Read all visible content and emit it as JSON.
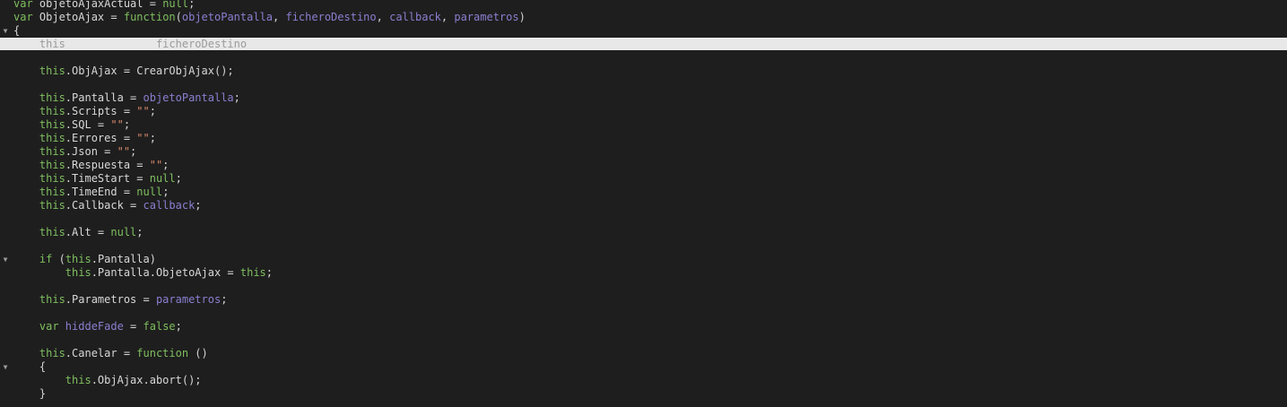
{
  "editor": {
    "lines": [
      {
        "y": 0,
        "fold": "",
        "tokens": [
          {
            "t": "var ",
            "c": "kw"
          },
          {
            "t": "objetoAjaxActual",
            "c": "id"
          },
          {
            "t": " = ",
            "c": "op"
          },
          {
            "t": "null",
            "c": "kw"
          },
          {
            "t": ";",
            "c": "op"
          }
        ]
      },
      {
        "y": 1,
        "fold": "",
        "tokens": [
          {
            "t": "var ",
            "c": "kw"
          },
          {
            "t": "ObjetoAjax",
            "c": "id"
          },
          {
            "t": " = ",
            "c": "op"
          },
          {
            "t": "function",
            "c": "kw"
          },
          {
            "t": "(",
            "c": "op"
          },
          {
            "t": "objetoPantalla",
            "c": "param"
          },
          {
            "t": ", ",
            "c": "op"
          },
          {
            "t": "ficheroDestino",
            "c": "param"
          },
          {
            "t": ", ",
            "c": "op"
          },
          {
            "t": "callback",
            "c": "param"
          },
          {
            "t": ", ",
            "c": "op"
          },
          {
            "t": "parametros",
            "c": "param"
          },
          {
            "t": ")",
            "c": "op"
          }
        ]
      },
      {
        "y": 2,
        "fold": "▼",
        "tokens": [
          {
            "t": "{",
            "c": "op"
          }
        ]
      },
      {
        "y": 3,
        "fold": "",
        "highlight": true,
        "tokens": [
          {
            "t": "    this",
            "c": "faded"
          },
          {
            "t": "              ",
            "c": "op"
          },
          {
            "t": "ficheroDestino",
            "c": "faded"
          }
        ]
      },
      {
        "y": 5,
        "fold": "",
        "tokens": [
          {
            "t": "    this",
            "c": "kw"
          },
          {
            "t": ".ObjAjax = ",
            "c": "id"
          },
          {
            "t": "CrearObjAjax",
            "c": "id"
          },
          {
            "t": "();",
            "c": "op"
          }
        ]
      },
      {
        "y": 7,
        "fold": "",
        "tokens": [
          {
            "t": "    this",
            "c": "kw"
          },
          {
            "t": ".Pantalla = ",
            "c": "id"
          },
          {
            "t": "objetoPantalla",
            "c": "param"
          },
          {
            "t": ";",
            "c": "op"
          }
        ]
      },
      {
        "y": 8,
        "fold": "",
        "tokens": [
          {
            "t": "    this",
            "c": "kw"
          },
          {
            "t": ".Scripts = ",
            "c": "id"
          },
          {
            "t": "\"\"",
            "c": "str"
          },
          {
            "t": ";",
            "c": "op"
          }
        ]
      },
      {
        "y": 9,
        "fold": "",
        "tokens": [
          {
            "t": "    this",
            "c": "kw"
          },
          {
            "t": ".SQL = ",
            "c": "id"
          },
          {
            "t": "\"\"",
            "c": "str"
          },
          {
            "t": ";",
            "c": "op"
          }
        ]
      },
      {
        "y": 10,
        "fold": "",
        "tokens": [
          {
            "t": "    this",
            "c": "kw"
          },
          {
            "t": ".Errores = ",
            "c": "id"
          },
          {
            "t": "\"\"",
            "c": "str"
          },
          {
            "t": ";",
            "c": "op"
          }
        ]
      },
      {
        "y": 11,
        "fold": "",
        "tokens": [
          {
            "t": "    this",
            "c": "kw"
          },
          {
            "t": ".Json = ",
            "c": "id"
          },
          {
            "t": "\"\"",
            "c": "str"
          },
          {
            "t": ";",
            "c": "op"
          }
        ]
      },
      {
        "y": 12,
        "fold": "",
        "tokens": [
          {
            "t": "    this",
            "c": "kw"
          },
          {
            "t": ".Respuesta = ",
            "c": "id"
          },
          {
            "t": "\"\"",
            "c": "str"
          },
          {
            "t": ";",
            "c": "op"
          }
        ]
      },
      {
        "y": 13,
        "fold": "",
        "tokens": [
          {
            "t": "    this",
            "c": "kw"
          },
          {
            "t": ".TimeStart = ",
            "c": "id"
          },
          {
            "t": "null",
            "c": "kw"
          },
          {
            "t": ";",
            "c": "op"
          }
        ]
      },
      {
        "y": 14,
        "fold": "",
        "tokens": [
          {
            "t": "    this",
            "c": "kw"
          },
          {
            "t": ".TimeEnd = ",
            "c": "id"
          },
          {
            "t": "null",
            "c": "kw"
          },
          {
            "t": ";",
            "c": "op"
          }
        ]
      },
      {
        "y": 15,
        "fold": "",
        "tokens": [
          {
            "t": "    this",
            "c": "kw"
          },
          {
            "t": ".Callback = ",
            "c": "id"
          },
          {
            "t": "callback",
            "c": "param"
          },
          {
            "t": ";",
            "c": "op"
          }
        ]
      },
      {
        "y": 17,
        "fold": "",
        "tokens": [
          {
            "t": "    this",
            "c": "kw"
          },
          {
            "t": ".Alt = ",
            "c": "id"
          },
          {
            "t": "null",
            "c": "kw"
          },
          {
            "t": ";",
            "c": "op"
          }
        ]
      },
      {
        "y": 19,
        "fold": "▼",
        "tokens": [
          {
            "t": "    if ",
            "c": "kw"
          },
          {
            "t": "(",
            "c": "op"
          },
          {
            "t": "this",
            "c": "kw"
          },
          {
            "t": ".Pantalla)",
            "c": "id"
          }
        ]
      },
      {
        "y": 20,
        "fold": "",
        "tokens": [
          {
            "t": "        this",
            "c": "kw"
          },
          {
            "t": ".Pantalla.ObjetoAjax = ",
            "c": "id"
          },
          {
            "t": "this",
            "c": "kw"
          },
          {
            "t": ";",
            "c": "op"
          }
        ]
      },
      {
        "y": 22,
        "fold": "",
        "tokens": [
          {
            "t": "    this",
            "c": "kw"
          },
          {
            "t": ".Parametros = ",
            "c": "id"
          },
          {
            "t": "parametros",
            "c": "param"
          },
          {
            "t": ";",
            "c": "op"
          }
        ]
      },
      {
        "y": 24,
        "fold": "",
        "tokens": [
          {
            "t": "    var ",
            "c": "kw"
          },
          {
            "t": "hiddeFade",
            "c": "param"
          },
          {
            "t": " = ",
            "c": "op"
          },
          {
            "t": "false",
            "c": "kw"
          },
          {
            "t": ";",
            "c": "op"
          }
        ]
      },
      {
        "y": 26,
        "fold": "",
        "tokens": [
          {
            "t": "    this",
            "c": "kw"
          },
          {
            "t": ".Canelar = ",
            "c": "id"
          },
          {
            "t": "function",
            "c": "kw"
          },
          {
            "t": " ()",
            "c": "op"
          }
        ]
      },
      {
        "y": 27,
        "fold": "▼",
        "tokens": [
          {
            "t": "    {",
            "c": "op"
          }
        ]
      },
      {
        "y": 28,
        "fold": "",
        "tokens": [
          {
            "t": "        this",
            "c": "kw"
          },
          {
            "t": ".ObjAjax.abort();",
            "c": "id"
          }
        ]
      },
      {
        "y": 29,
        "fold": "",
        "tokens": [
          {
            "t": "    }",
            "c": "op"
          }
        ]
      }
    ]
  }
}
